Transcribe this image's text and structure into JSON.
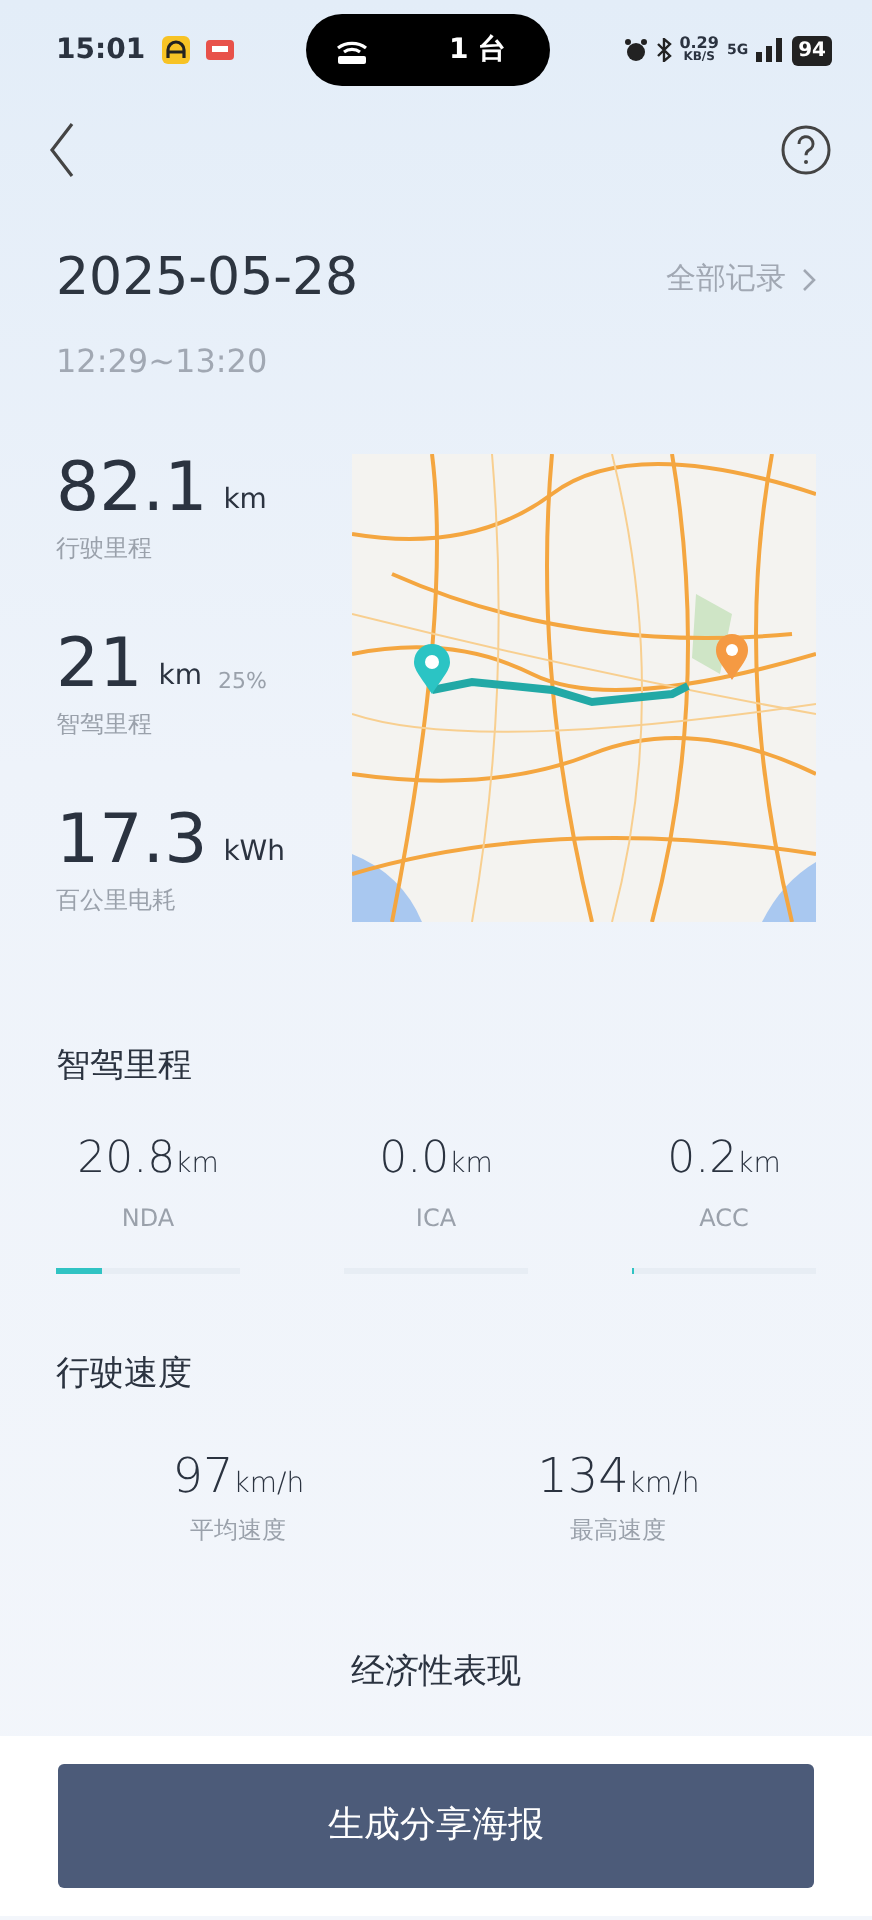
{
  "status_bar": {
    "time": "15:01",
    "island_text": "1 台",
    "net_speed": "0.29",
    "net_unit": "KB/S",
    "network": "5G",
    "battery": "94"
  },
  "header": {
    "date": "2025-05-28",
    "time_range": "12:29~13:20",
    "all_records": "全部记录"
  },
  "stats": [
    {
      "value": "82.1",
      "unit": "km",
      "label": "行驶里程"
    },
    {
      "value": "21",
      "unit": "km",
      "extra": "25%",
      "label": "智驾里程"
    },
    {
      "value": "17.3",
      "unit": "kWh",
      "label": "百公里电耗"
    }
  ],
  "assist_section": {
    "title": "智驾里程",
    "modes": [
      {
        "value": "20.8",
        "unit": "km",
        "label": "NDA",
        "level": 0.25
      },
      {
        "value": "0.0",
        "unit": "km",
        "label": "ICA"
      },
      {
        "value": "0.2",
        "unit": "km",
        "label": "ACC",
        "level": 0.01
      }
    ]
  },
  "speed_section": {
    "title": "行驶速度",
    "items": [
      {
        "value": "97",
        "unit": "km/h",
        "label": "平均速度"
      },
      {
        "value": "134",
        "unit": "km/h",
        "label": "最高速度"
      }
    ]
  },
  "economy_title": "经济性表现",
  "share_button": "生成分享海报"
}
